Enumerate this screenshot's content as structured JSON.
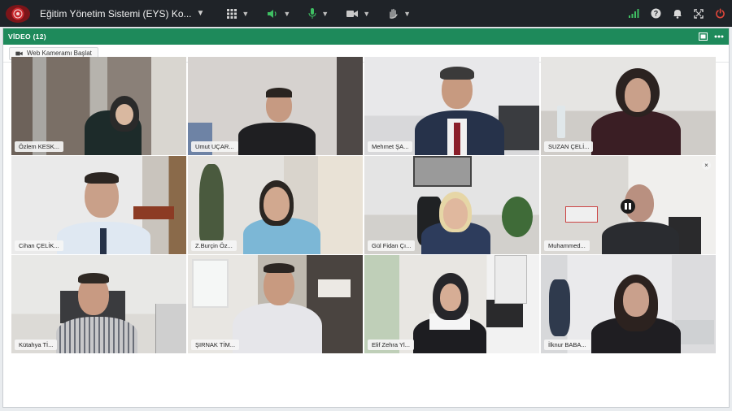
{
  "topbar": {
    "title": "Eğitim Yönetim Sistemi (EYS) Ko...",
    "icons": [
      "grid-icon",
      "speaker-icon",
      "microphone-icon",
      "camera-icon",
      "raise-hand-icon",
      "signal-icon",
      "help-icon",
      "bell-icon",
      "fullscreen-icon",
      "power-icon"
    ]
  },
  "panel": {
    "title": "VİDEO (12)",
    "camera_button": "Web Kameramı Başlat"
  },
  "participants": [
    {
      "name": "Özlem KESK..."
    },
    {
      "name": "Umut UÇAR..."
    },
    {
      "name": "Mehmet ŞA..."
    },
    {
      "name": "SUZAN ÇELİ..."
    },
    {
      "name": "Cihan ÇELİK..."
    },
    {
      "name": "Z.Burçin Öz..."
    },
    {
      "name": "Gül Fidan Çı..."
    },
    {
      "name": "Muhammed..."
    },
    {
      "name": "Kütahya Tİ..."
    },
    {
      "name": "ŞIRNAK TİM..."
    },
    {
      "name": "Elif Zehra Yl..."
    },
    {
      "name": "İlknur BABA..."
    }
  ],
  "colors": {
    "topbar_bg": "#1f2328",
    "panel_header": "#1e8a5b",
    "accent_green": "#3fbf63",
    "power_red": "#e0463a"
  }
}
